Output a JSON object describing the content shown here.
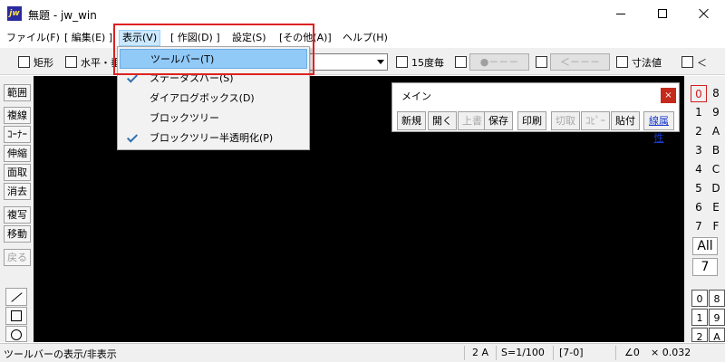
{
  "window": {
    "app_icon_text": "jw",
    "title": "無題 - jw_win"
  },
  "menubar": [
    {
      "label": "ファイル(F)",
      "active": false
    },
    {
      "label": "[ 編集(E) ]",
      "active": false
    },
    {
      "label": "表示(V)",
      "active": true
    },
    {
      "label": "[ 作図(D) ]",
      "active": false
    },
    {
      "label": "設定(S)",
      "active": false
    },
    {
      "label": "[その他(A)]",
      "active": false
    },
    {
      "label": "ヘルプ(H)",
      "active": false
    }
  ],
  "toolbar": {
    "rect_label": "矩形",
    "horiz_label": "水平・垂",
    "deg15_label": "15度毎",
    "btn_circle": "●－－－",
    "btn_arrow": "＜－－－",
    "dim_label": "寸法値",
    "lt_label": "＜"
  },
  "left_tools": [
    {
      "label": "範囲",
      "disabled": false
    },
    {
      "label": "複線",
      "disabled": false
    },
    {
      "label": "ｺｰﾅｰ",
      "disabled": false
    },
    {
      "label": "伸縮",
      "disabled": false
    },
    {
      "label": "面取",
      "disabled": false
    },
    {
      "label": "消去",
      "disabled": false
    },
    {
      "label": "複写",
      "disabled": false
    },
    {
      "label": "移動",
      "disabled": false
    },
    {
      "label": "戻る",
      "disabled": true
    }
  ],
  "shape_icons": [
    "line-tool-icon",
    "rectangle-tool-icon",
    "circle-tool-icon"
  ],
  "layers_left": [
    "0",
    "1",
    "2",
    "3",
    "4",
    "5",
    "6",
    "7"
  ],
  "layers_right": [
    "8",
    "9",
    "A",
    "B",
    "C",
    "D",
    "E",
    "F"
  ],
  "layer_all": "All",
  "layer_current": "7",
  "group_left": [
    "0",
    "1",
    "2"
  ],
  "group_right": [
    "8",
    "9",
    "A"
  ],
  "main_window": {
    "title": "メイン",
    "close": "×",
    "buttons": [
      {
        "label": "新規",
        "disabled": false
      },
      {
        "label": "開く",
        "disabled": false
      },
      {
        "label": "上書",
        "disabled": true
      },
      {
        "label": "保存",
        "disabled": false
      },
      {
        "label": "印刷",
        "disabled": false
      },
      {
        "label": "切取",
        "disabled": true
      },
      {
        "label": "ｺﾋﾟｰ",
        "disabled": true
      },
      {
        "label": "貼付",
        "disabled": false
      },
      {
        "label": "線属性",
        "disabled": false
      }
    ]
  },
  "view_menu": [
    {
      "label": "ツールバー(T)",
      "checked": false,
      "hover": true
    },
    {
      "label": "ステータスバー(S)",
      "checked": true,
      "hover": false
    },
    {
      "label": "ダイアログボックス(D)",
      "checked": false,
      "hover": false
    },
    {
      "label": "ブロックツリー",
      "checked": false,
      "hover": false
    },
    {
      "label": "ブロックツリー半透明化(P)",
      "checked": true,
      "hover": false
    }
  ],
  "statusbar": {
    "message": "ツールバーの表示/非表示",
    "paper": "2 A",
    "scale": "S=1/100",
    "layer": "[7-0]",
    "angle": "∠0",
    "multiplier": "× 0.032"
  },
  "colors": {
    "highlight": "#e02020",
    "menu_hover": "#91c9f7",
    "accent_link": "#1a3ccc"
  }
}
